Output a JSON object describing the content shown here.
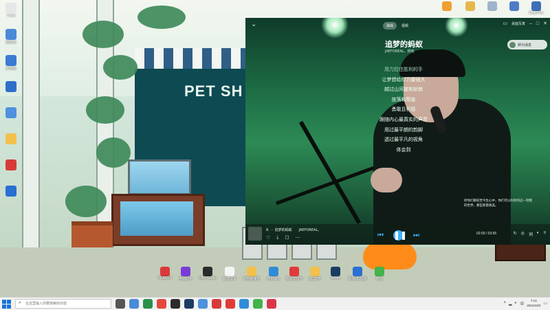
{
  "desktop": {
    "left_icons": [
      {
        "label": "Trash",
        "color": "#e6e6e6"
      },
      {
        "label": "回收站",
        "color": "#4a8ad8"
      },
      {
        "label": "此电脑",
        "color": "#3b7bd4"
      },
      {
        "label": "",
        "color": "#2f6fc9"
      },
      {
        "label": "",
        "color": "#4e91dd"
      },
      {
        "label": "",
        "color": "#f2c14b"
      },
      {
        "label": "",
        "color": "#d83a3a"
      },
      {
        "label": "",
        "color": "#2a6fd1"
      }
    ],
    "top_icons": [
      {
        "label": "",
        "color": "#f0a030"
      },
      {
        "label": "",
        "color": "#e8b74a"
      },
      {
        "label": "",
        "color": "#9fb3c9"
      },
      {
        "label": "",
        "color": "#4e7cc6"
      },
      {
        "label": "EasyPlan",
        "color": "#3e6fb8"
      }
    ],
    "bottom_icons": [
      {
        "label": "PEADER",
        "color": "#d83a3a"
      },
      {
        "label": "电脑助手",
        "color": "#7a3ad8"
      },
      {
        "label": "OBS Studio",
        "color": "#2b2b2b"
      },
      {
        "label": "新建文本",
        "color": "#f4f4f4"
      },
      {
        "label": "云电脑服务",
        "color": "#f2c14b"
      },
      {
        "label": "搜狗输入",
        "color": "#2f8cd8"
      },
      {
        "label": "网易云音乐",
        "color": "#e03a3a"
      },
      {
        "label": "QQ音乐",
        "color": "#f2c14b"
      },
      {
        "label": "Steam",
        "color": "#1b3c62"
      },
      {
        "label": "网易UU加速",
        "color": "#2a6fd1"
      },
      {
        "label": "微信",
        "color": "#43b34a"
      }
    ]
  },
  "player": {
    "tabs": [
      {
        "label": "歌曲",
        "active": true
      },
      {
        "label": "视频",
        "active": false
      }
    ],
    "top_icons": [
      "minimize-icon",
      "maximize-icon",
      "close-icon"
    ],
    "top_text": "桌面写真",
    "title": "追梦的蚂蚁",
    "artist": "JAEFOREAL、杨宪",
    "lyrics": [
      {
        "text": "用力拉住胜利的手",
        "state": "dim"
      },
      {
        "text": "让梦想给你力量强大",
        "state": "normal"
      },
      {
        "text": "越过山河披荆斩棘",
        "state": "normal"
      },
      {
        "text": "放荡和颓废",
        "state": "normal"
      },
      {
        "text": "勇敢且积极",
        "state": "normal"
      },
      {
        "text": "跟随内心最真实的声音",
        "state": "normal"
      },
      {
        "text": "用过最平朗的韵脚",
        "state": "normal"
      },
      {
        "text": "透过最平凡的视角",
        "state": "normal"
      },
      {
        "text": "体会到",
        "state": "normal"
      }
    ],
    "side_user": "转为消息",
    "side_comment": "听你们聊前世今生心中，你们可以吗听的这一刻我的世界，那些新歌很美。",
    "now_playing": {
      "index": "8.",
      "title": "追梦的蚂蚁",
      "artist": "JAEFOREAL、"
    },
    "time": "02:00 / 03:55",
    "accent": "#3fb3ff"
  },
  "taskbar": {
    "search_placeholder": "在这里输入你要搜索的内容",
    "apps": [
      "#555555",
      "#4a8ad8",
      "#2a8f4a",
      "#e24a3a",
      "#2b2b2b",
      "#1b3c62",
      "#4e91dd",
      "#d83a3a",
      "#e03a3a",
      "#2f8cd8",
      "#43b34a",
      "#d8364a"
    ],
    "clock_time": "7:13",
    "clock_date": "2021/10/2"
  }
}
